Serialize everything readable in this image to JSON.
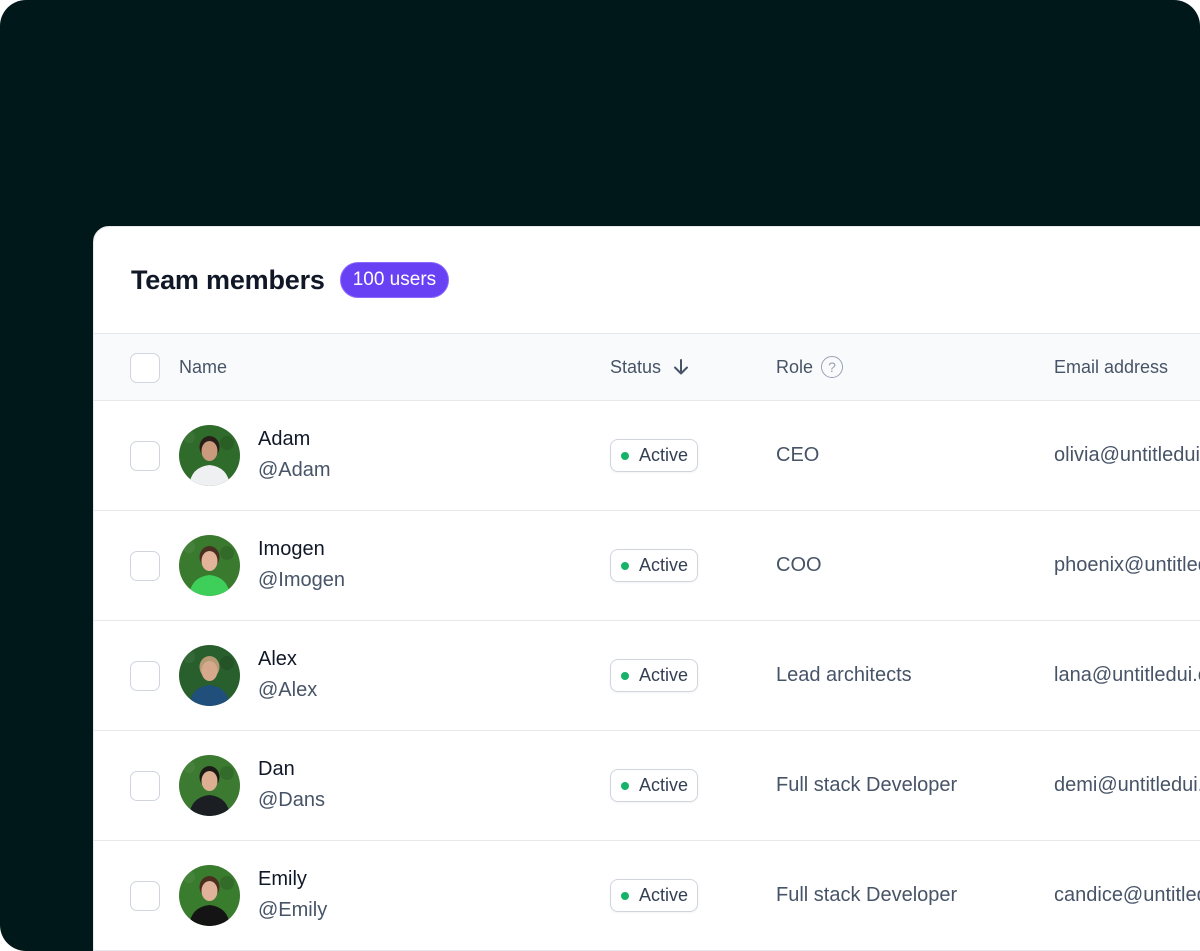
{
  "header": {
    "title": "Team members",
    "count_badge": "100 users"
  },
  "table": {
    "columns": {
      "name": "Name",
      "status": "Status",
      "role": "Role",
      "email": "Email address"
    },
    "sort_icon": "arrow-down-icon",
    "role_help_icon": "help-circle-icon",
    "rows": [
      {
        "name": "Adam",
        "handle": "@Adam",
        "status": "Active",
        "role": "CEO",
        "email": "olivia@untitledui.com",
        "avatar_colors": {
          "bg": "#2f6b2a",
          "skin": "#c99a7c",
          "shirt": "#eef0f2",
          "hair": "#2a1e18"
        }
      },
      {
        "name": "Imogen",
        "handle": "@Imogen",
        "status": "Active",
        "role": "COO",
        "email": "phoenix@untitledui.com",
        "avatar_colors": {
          "bg": "#3a7a2f",
          "skin": "#e3b49a",
          "shirt": "#3ecf5a",
          "hair": "#4a3020"
        }
      },
      {
        "name": "Alex",
        "handle": "@Alex",
        "status": "Active",
        "role": "Lead architects",
        "email": "lana@untitledui.com",
        "avatar_colors": {
          "bg": "#285f2c",
          "skin": "#d7a98c",
          "shirt": "#1f4f7a",
          "hair": "#b59a74"
        }
      },
      {
        "name": "Dan",
        "handle": "@Dans",
        "status": "Active",
        "role": "Full stack Developer",
        "email": "demi@untitledui.com",
        "avatar_colors": {
          "bg": "#3b7a30",
          "skin": "#dcae92",
          "shirt": "#1b1f24",
          "hair": "#1e1a16"
        }
      },
      {
        "name": "Emily",
        "handle": "@Emily",
        "status": "Active",
        "role": "Full stack Developer",
        "email": "candice@untitledui.com",
        "avatar_colors": {
          "bg": "#3a7c2e",
          "skin": "#e0b29a",
          "shirt": "#141414",
          "hair": "#4b2e1e"
        }
      }
    ]
  },
  "colors": {
    "backdrop": "#01181b",
    "accent": "#6941f5",
    "status_active": "#17b26a"
  }
}
